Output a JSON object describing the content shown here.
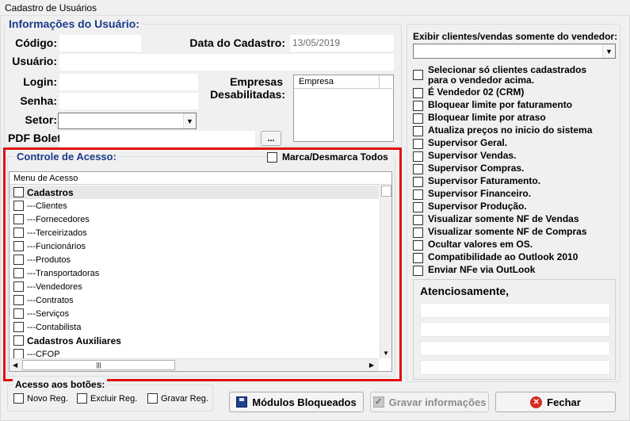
{
  "window": {
    "title": "Cadastro de Usuários"
  },
  "user_info": {
    "title": "Informações do Usuário:",
    "codigo_label": "Código:",
    "data_cadastro_label": "Data do Cadastro:",
    "data_cadastro_value": "13/05/2019",
    "usuario_label": "Usuário:",
    "login_label": "Login:",
    "senha_label": "Senha:",
    "setor_label": "Setor:",
    "pdf_boleto_label": "PDF Boleto:",
    "pdf_button": "...",
    "empresas_label_1": "Empresas",
    "empresas_label_2": "Desabilitadas:",
    "empresa_col": "Empresa"
  },
  "access": {
    "title": "Controle de Acesso:",
    "toggle_all": "Marca/Desmarca Todos",
    "column_header": "Menu de Acesso",
    "items": [
      {
        "label": "Cadastros",
        "bold": true
      },
      {
        "label": "---Clientes",
        "bold": false
      },
      {
        "label": "---Fornecedores",
        "bold": false
      },
      {
        "label": "---Terceirizados",
        "bold": false
      },
      {
        "label": "---Funcionários",
        "bold": false
      },
      {
        "label": "---Produtos",
        "bold": false
      },
      {
        "label": "---Transportadoras",
        "bold": false
      },
      {
        "label": "---Vendedores",
        "bold": false
      },
      {
        "label": "---Contratos",
        "bold": false
      },
      {
        "label": "---Serviços",
        "bold": false
      },
      {
        "label": "---Contabilista",
        "bold": false
      },
      {
        "label": "Cadastros Auxiliares",
        "bold": true
      },
      {
        "label": "---CFOP",
        "bold": false
      }
    ]
  },
  "right_panel": {
    "exibir_label": "Exibir clientes/vendas somente do vendedor:",
    "options": [
      "Selecionar só clientes cadastrados\npara o vendedor acima.",
      "É Vendedor 02 (CRM)",
      "Bloquear limite por faturamento",
      "Bloquear limite por atraso",
      "Atualiza preços no inicio do sistema",
      "Supervisor Geral.",
      "Supervisor Vendas.",
      "Supervisor Compras.",
      "Supervisor Faturamento.",
      "Supervisor Financeiro.",
      "Supervisor Produção.",
      "Visualizar somente NF de Vendas",
      "Visualizar somente NF de Compras",
      "Ocultar valores em OS.",
      "Compatibilidade ao Outlook 2010",
      "Enviar NFe via OutLook"
    ],
    "atenciosamente": "Atenciosamente,"
  },
  "buttons_access": {
    "title": "Acesso aos botões:",
    "novo": "Novo Reg.",
    "excluir": "Excluir Reg.",
    "gravar": "Gravar Reg."
  },
  "actions": {
    "modulos": "Módulos Bloqueados",
    "gravar": "Gravar informações",
    "fechar": "Fechar"
  },
  "colors": {
    "accent_title": "#1a3a8a",
    "highlight_border": "#e01010"
  }
}
